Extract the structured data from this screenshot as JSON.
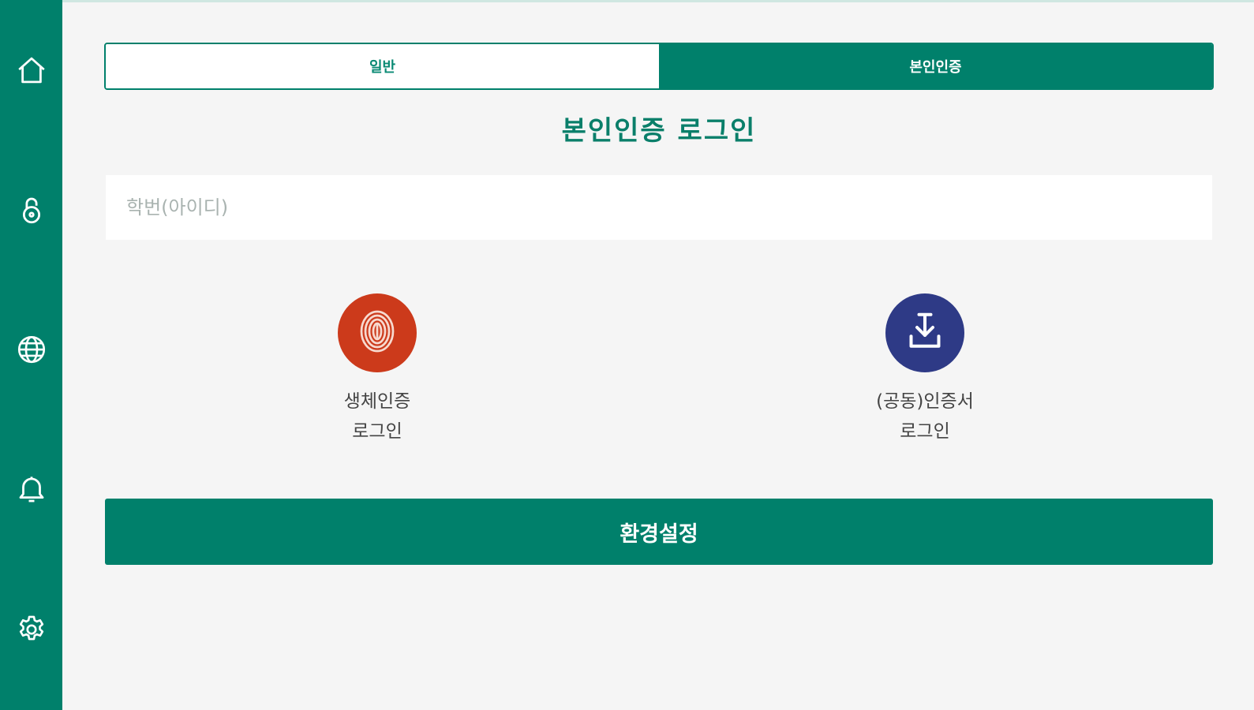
{
  "sidebar": {
    "items": [
      {
        "icon": "home-icon"
      },
      {
        "icon": "lock-icon"
      },
      {
        "icon": "globe-icon"
      },
      {
        "icon": "bell-icon"
      },
      {
        "icon": "gear-icon"
      }
    ]
  },
  "tabs": {
    "general_label": "일반",
    "cert_label": "본인인증",
    "active": "본인인증"
  },
  "main": {
    "title": "본인인증 로그인",
    "id_input": {
      "placeholder": "학번(아이디)",
      "value": ""
    },
    "biometric": {
      "icon": "fingerprint-icon",
      "line1": "생체인증",
      "line2": "로그인"
    },
    "certificate": {
      "icon": "download-icon",
      "line1": "(공동)인증서",
      "line2": "로그인"
    },
    "settings_label": "환경설정"
  },
  "colors": {
    "primary": "#00806b",
    "biometric": "#cc3a1b",
    "certificate": "#2e3a86",
    "background": "#f5f5f5"
  }
}
